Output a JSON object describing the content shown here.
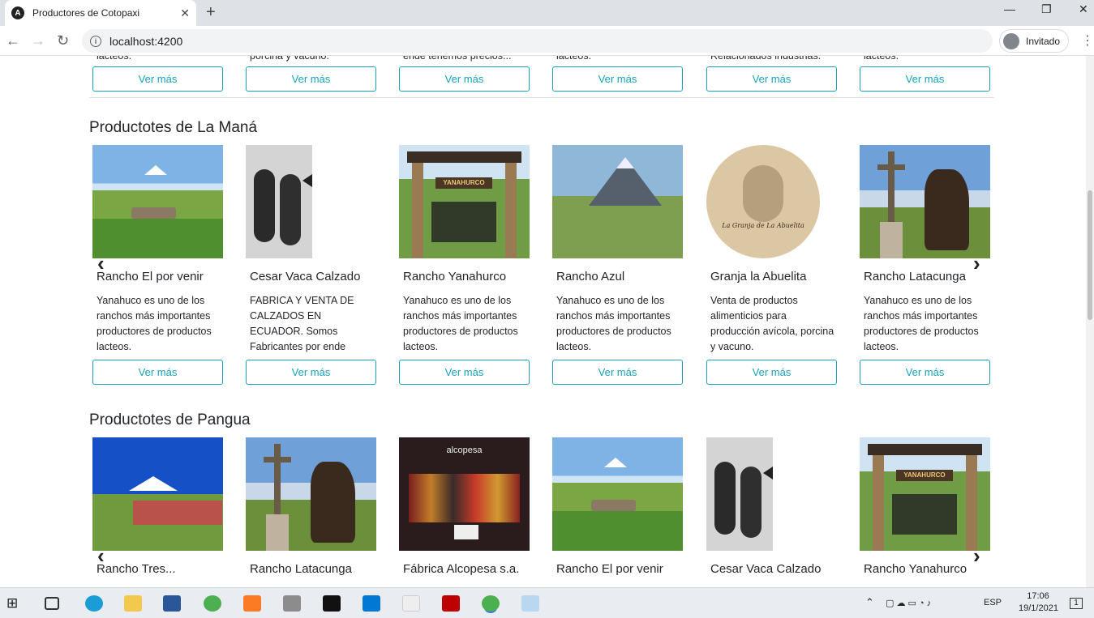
{
  "browser": {
    "tab_title": "Productores de Cotopaxi",
    "tab_icon": "A",
    "new_tab": "+",
    "url": "localhost:4200",
    "profile_label": "Invitado"
  },
  "top_buttons": [
    "Ver más",
    "Ver más",
    "Ver más",
    "Ver más",
    "Ver más",
    "Ver más"
  ],
  "top_desc_fragments": [
    "lacteos.",
    "porcina y vacuno.",
    "ende tenemos precios...",
    "lacteos.",
    "Relacionados industrias.",
    "lacteos."
  ],
  "sections": [
    {
      "title": "Productotes de La Maná",
      "cards": [
        {
          "name": "Rancho El por venir",
          "desc": "Yanahuco es uno de los ranchos más importantes productores de productos lacteos.",
          "button": "Ver más"
        },
        {
          "name": "Cesar Vaca Calzado",
          "desc": "FABRICA Y VENTA DE CALZADOS EN ECUADOR. Somos Fabricantes por ende tenemos precios...",
          "button": "Ver más"
        },
        {
          "name": "Rancho Yanahurco",
          "desc": "Yanahuco es uno de los ranchos más importantes productores de productos lacteos.",
          "button": "Ver más",
          "sign": "YANAHURCO"
        },
        {
          "name": "Rancho Azul",
          "desc": "Yanahuco es uno de los ranchos más importantes productores de productos lacteos.",
          "button": "Ver más"
        },
        {
          "name": "Granja la Abuelita",
          "desc": "Venta de productos alimenticios para producción avícola, porcina y vacuno.",
          "button": "Ver más",
          "sign": "La Granja de La Abuelita"
        },
        {
          "name": "Rancho Latacunga",
          "desc": "Yanahuco es uno de los ranchos más importantes productores de productos lacteos.",
          "button": "Ver más"
        }
      ]
    },
    {
      "title": "Productotes de Pangua",
      "cards": [
        {
          "name": "Rancho Tres..."
        },
        {
          "name": "Rancho Latacunga"
        },
        {
          "name": "Fábrica Alcopesa s.a.",
          "sign": "alcopesa"
        },
        {
          "name": "Rancho El por venir"
        },
        {
          "name": "Cesar Vaca Calzado"
        },
        {
          "name": "Rancho Yanahurco",
          "sign": "YANAHURCO"
        }
      ]
    }
  ],
  "carousel": {
    "prev": "‹",
    "next": "›"
  },
  "taskbar": {
    "lang": "ESP",
    "time": "17:06",
    "date": "19/1/2021",
    "notif": "1"
  }
}
